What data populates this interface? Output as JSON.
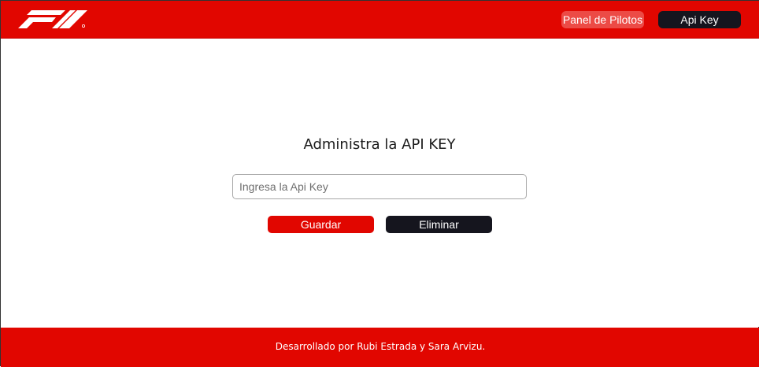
{
  "header": {
    "logo": "F1",
    "nav": {
      "pilots_label": "Panel de Pilotos",
      "api_key_label": "Api Key"
    }
  },
  "main": {
    "title": "Administra la API KEY",
    "input": {
      "placeholder": "Ingresa la Api Key",
      "value": ""
    },
    "buttons": {
      "save_label": "Guardar",
      "delete_label": "Eliminar"
    }
  },
  "footer": {
    "text": "Desarrollado por Rubi Estrada y Sara Arvizu."
  },
  "colors": {
    "brand_red": "#e10600",
    "dark": "#15151e",
    "nav_active": "#ec4b46"
  }
}
